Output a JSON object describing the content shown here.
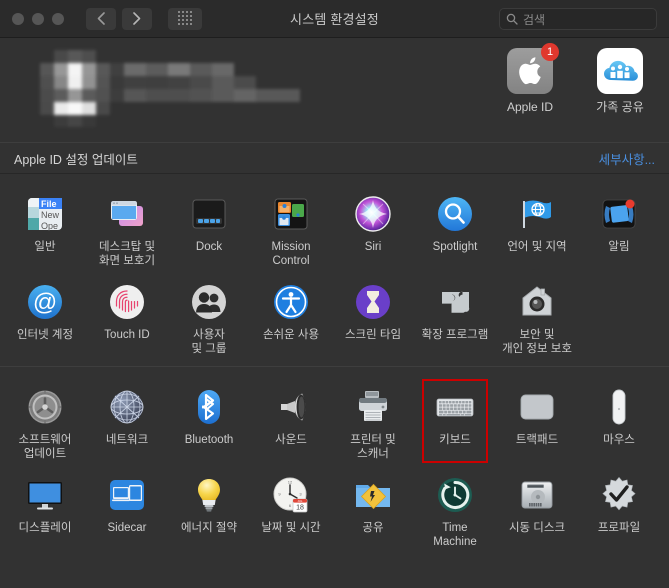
{
  "window": {
    "title": "시스템 환경설정",
    "traffic_lights": [
      "close",
      "minimize",
      "zoom"
    ],
    "nav": {
      "back": "back-chevron",
      "forward": "forward-chevron",
      "show_all": "grid-button"
    },
    "search": {
      "placeholder": "검색",
      "value": "",
      "icon": "search-icon"
    }
  },
  "account": {
    "user_name_redacted": "",
    "items": [
      {
        "label": "Apple ID",
        "icon": "apple-logo-icon",
        "badge": "1"
      },
      {
        "label": "가족\n공유",
        "icon": "family-sharing-icon",
        "badge": ""
      }
    ]
  },
  "notice": {
    "text": "Apple ID 설정 업데이트",
    "link": "세부사항...",
    "link_color": "#4a8fe0"
  },
  "highlight": {
    "color": "#cc0000",
    "target": "키보드"
  },
  "sections": [
    {
      "name": "personal",
      "rows": [
        [
          {
            "label": "일반",
            "icon": "general-icon"
          },
          {
            "label": "데스크탑 및\n화면 보호기",
            "icon": "desktop-screensaver-icon"
          },
          {
            "label": "Dock",
            "icon": "dock-icon"
          },
          {
            "label": "Mission\nControl",
            "icon": "mission-control-icon"
          },
          {
            "label": "Siri",
            "icon": "siri-icon"
          },
          {
            "label": "Spotlight",
            "icon": "spotlight-icon"
          },
          {
            "label": "언어 및 지역",
            "icon": "language-region-icon"
          },
          {
            "label": "알림",
            "icon": "notifications-icon"
          }
        ],
        [
          {
            "label": "인터넷 계정",
            "icon": "internet-accounts-icon"
          },
          {
            "label": "Touch ID",
            "icon": "touch-id-icon"
          },
          {
            "label": "사용자\n및 그룹",
            "icon": "users-groups-icon"
          },
          {
            "label": "손쉬운 사용",
            "icon": "accessibility-icon"
          },
          {
            "label": "스크린 타임",
            "icon": "screen-time-icon"
          },
          {
            "label": "확장 프로그램",
            "icon": "extensions-icon"
          },
          {
            "label": "보안 및\n개인 정보 보호",
            "icon": "security-privacy-icon"
          }
        ]
      ]
    },
    {
      "name": "hardware",
      "rows": [
        [
          {
            "label": "소프트웨어\n업데이트",
            "icon": "software-update-icon"
          },
          {
            "label": "네트워크",
            "icon": "network-icon"
          },
          {
            "label": "Bluetooth",
            "icon": "bluetooth-icon"
          },
          {
            "label": "사운드",
            "icon": "sound-icon"
          },
          {
            "label": "프린터 및\n스캐너",
            "icon": "printers-scanners-icon"
          },
          {
            "label": "키보드",
            "icon": "keyboard-icon"
          },
          {
            "label": "트랙패드",
            "icon": "trackpad-icon"
          },
          {
            "label": "마우스",
            "icon": "mouse-icon"
          }
        ],
        [
          {
            "label": "디스플레이",
            "icon": "displays-icon"
          },
          {
            "label": "Sidecar",
            "icon": "sidecar-icon"
          },
          {
            "label": "에너지 절약",
            "icon": "energy-saver-icon"
          },
          {
            "label": "날짜 및 시간",
            "icon": "date-time-icon"
          },
          {
            "label": "공유",
            "icon": "sharing-icon"
          },
          {
            "label": "Time\nMachine",
            "icon": "time-machine-icon"
          },
          {
            "label": "시동 디스크",
            "icon": "startup-disk-icon"
          },
          {
            "label": "프로파일",
            "icon": "profiles-icon"
          }
        ]
      ]
    }
  ]
}
